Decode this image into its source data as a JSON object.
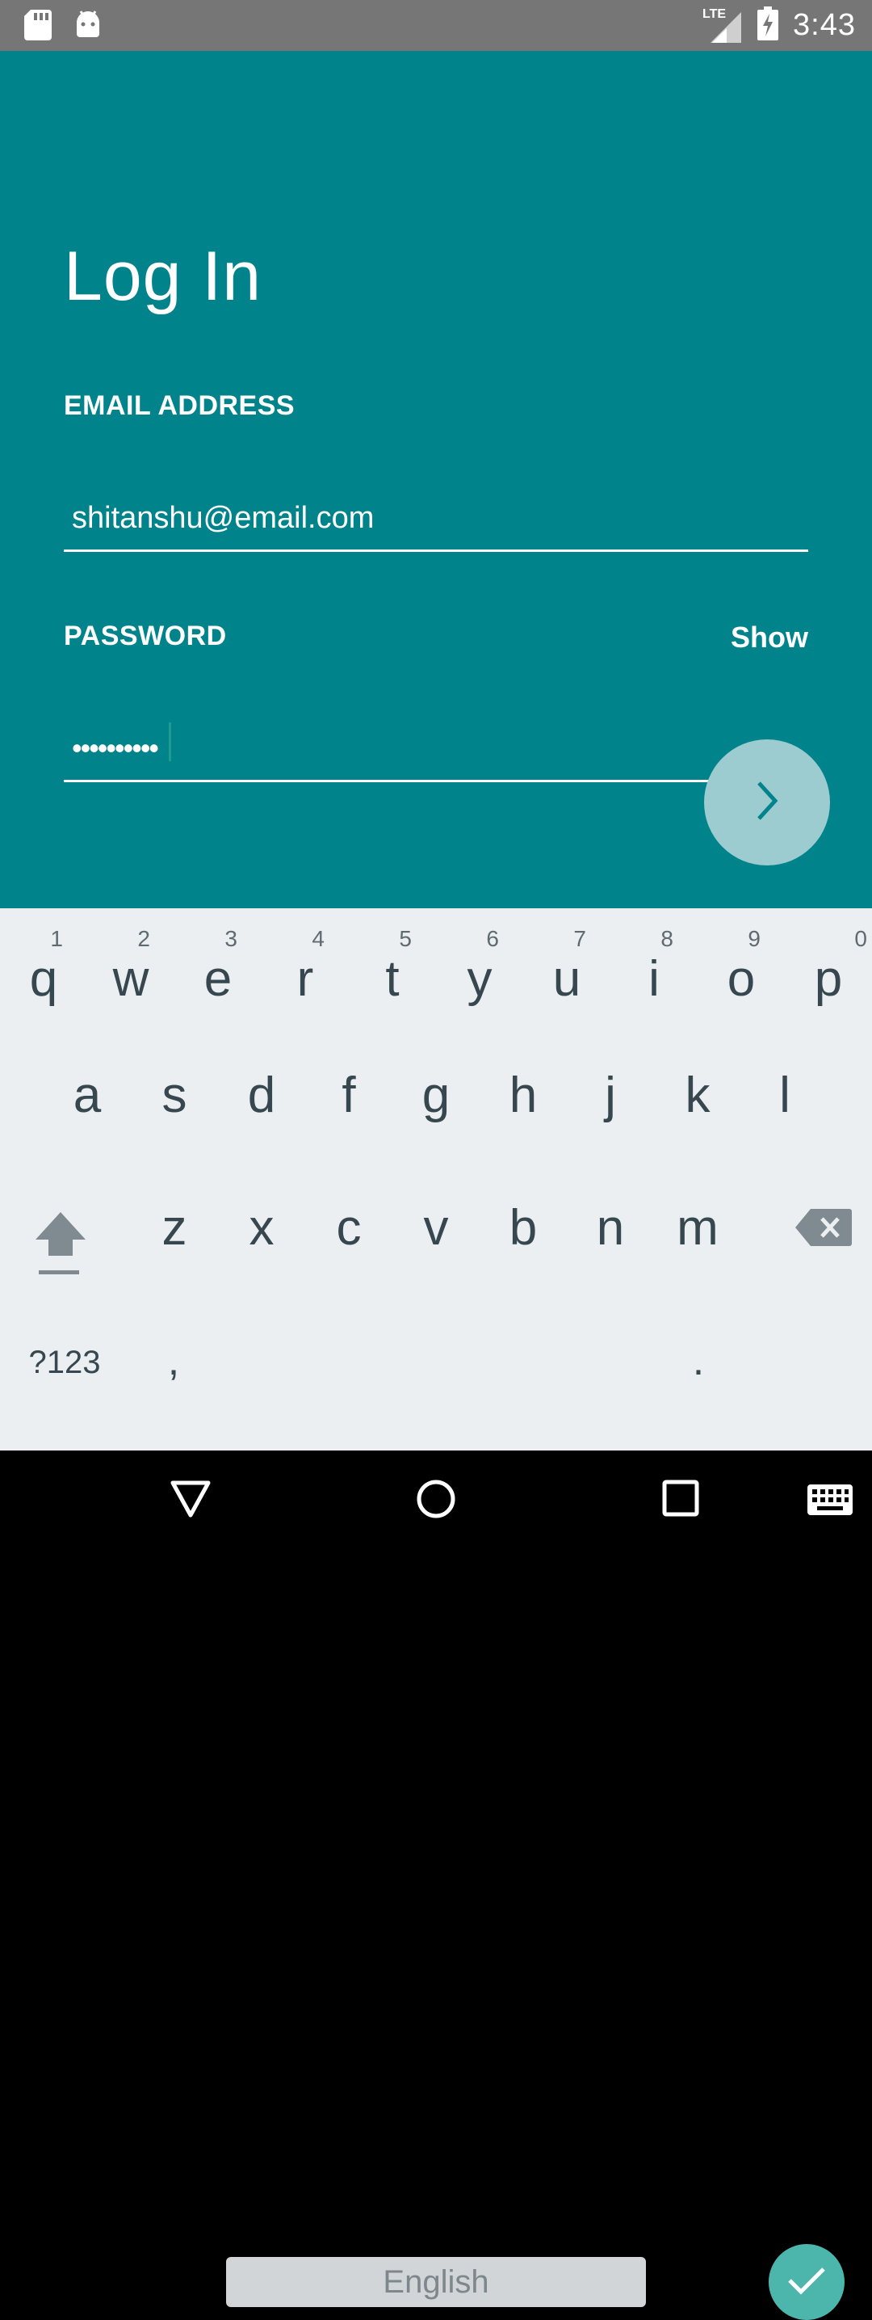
{
  "status_bar": {
    "time": "3:43",
    "network": "LTE",
    "icons": [
      "sd-card-icon",
      "android-icon",
      "signal-icon",
      "battery-charging-icon"
    ]
  },
  "login": {
    "title": "Log In",
    "email_label": "EMAIL ADDRESS",
    "email_value": "shitanshu@email.com",
    "password_label": "PASSWORD",
    "password_value": "••••••••••",
    "show_label": "Show",
    "next_icon": "chevron-right-icon"
  },
  "keyboard": {
    "row1": [
      {
        "letter": "q",
        "hint": "1"
      },
      {
        "letter": "w",
        "hint": "2"
      },
      {
        "letter": "e",
        "hint": "3"
      },
      {
        "letter": "r",
        "hint": "4"
      },
      {
        "letter": "t",
        "hint": "5"
      },
      {
        "letter": "y",
        "hint": "6"
      },
      {
        "letter": "u",
        "hint": "7"
      },
      {
        "letter": "i",
        "hint": "8"
      },
      {
        "letter": "o",
        "hint": "9"
      },
      {
        "letter": "p",
        "hint": "0"
      }
    ],
    "row2": [
      "a",
      "s",
      "d",
      "f",
      "g",
      "h",
      "j",
      "k",
      "l"
    ],
    "row3": [
      "z",
      "x",
      "c",
      "v",
      "b",
      "n",
      "m"
    ],
    "symbols_label": "?123",
    "comma": ",",
    "space_label": "English",
    "period": ".",
    "done_icon": "checkmark-icon"
  },
  "nav_bar": {
    "icons": [
      "back-icon",
      "home-icon",
      "recents-icon",
      "keyboard-icon"
    ]
  }
}
